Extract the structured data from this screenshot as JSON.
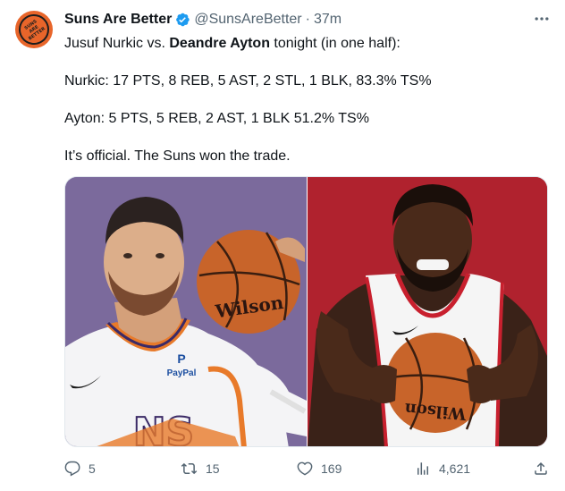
{
  "author": {
    "display_name": "Suns Are Better",
    "handle": "@SunsAreBetter",
    "separator": "·",
    "time": "37m",
    "avatar_text": "SUNS ARE BETTER",
    "verified_icon": "verified-badge-icon",
    "more_icon": "more-options-icon"
  },
  "tweet": {
    "line1_prefix": "Jusuf Nurkic vs. ",
    "line1_bold": "Deandre Ayton",
    "line1_suffix": " tonight (in one half):",
    "line2": "Nurkic: 17 PTS, 8 REB, 5 AST, 2 STL, 1 BLK, 83.3% TS%",
    "line3": "Ayton: 5 PTS, 5 REB, 2 AST, 1 BLK 51.2% TS%",
    "line4": "It’s official. The Suns won the trade."
  },
  "media": {
    "left_ball_text": "Wilson",
    "left_jersey_sponsor": "PayPal",
    "left_jersey_text": "NS",
    "right_ball_text": "Wilson"
  },
  "actions": {
    "replies": "5",
    "retweets": "15",
    "likes": "169",
    "views": "4,621"
  },
  "colors": {
    "text_primary": "#0f1419",
    "text_secondary": "#536471",
    "verified_blue": "#1d9bf0",
    "avatar_orange": "#e8652a",
    "left_photo_bg": "#7b6a9c",
    "right_photo_bg": "#b0222e"
  }
}
